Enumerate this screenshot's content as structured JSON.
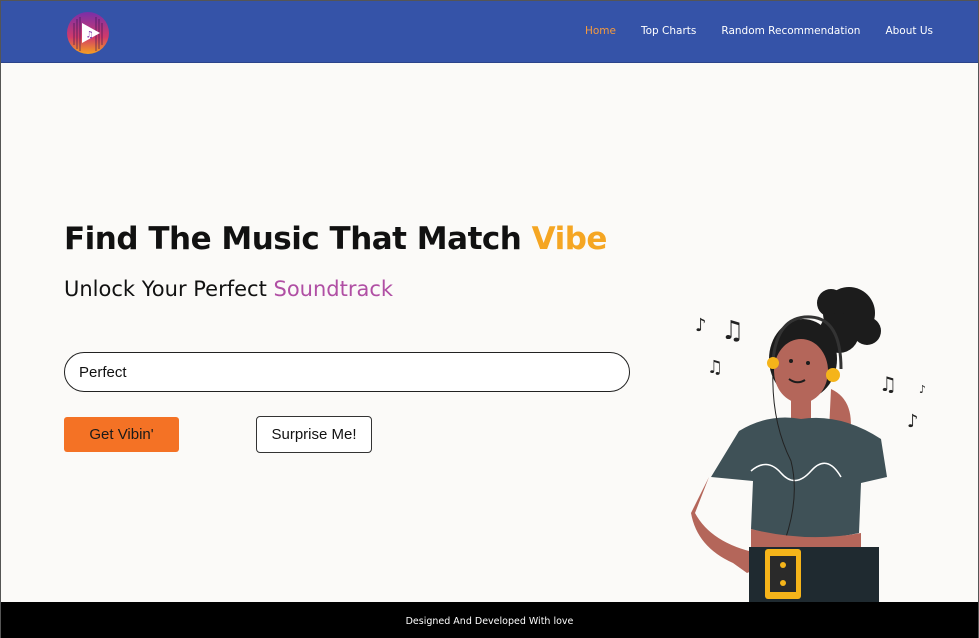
{
  "nav": {
    "items": [
      "Home",
      "Top Charts",
      "Random Recommendation",
      "About Us"
    ]
  },
  "hero": {
    "title_main": "Find The Music That Match ",
    "title_accent": "Vibe",
    "subtitle_main": "Unlock Your Perfect ",
    "subtitle_accent": "Soundtrack"
  },
  "search": {
    "value": "Perfect"
  },
  "buttons": {
    "primary": "Get Vibin'",
    "secondary": "Surprise Me!"
  },
  "footer": {
    "text": "Designed And Developed With love"
  },
  "colors": {
    "navbar": "#3553a8",
    "active_link": "#f59a3e",
    "title_accent": "#f5a623",
    "subtitle_accent": "#b04fa4",
    "primary_button": "#f47225",
    "footer": "#000000"
  },
  "icons": {
    "logo": "music-play-logo-icon",
    "notes": "music-note-icon"
  }
}
